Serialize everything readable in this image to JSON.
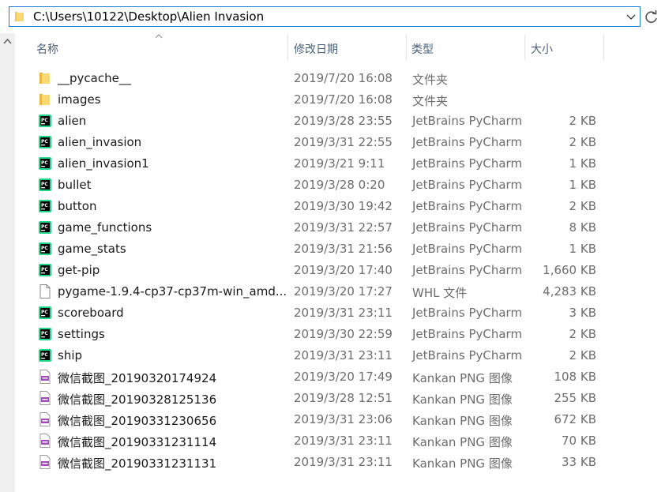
{
  "address_bar": {
    "path": "C:\\Users\\10122\\Desktop\\Alien Invasion"
  },
  "columns": {
    "name": "名称",
    "date": "修改日期",
    "type": "类型",
    "size": "大小"
  },
  "icons": {
    "folder": "folder-icon",
    "py": "pycharm-file-icon",
    "whl": "blank-file-icon",
    "png": "png-file-icon"
  },
  "colors": {
    "address_border": "#1e7bd6",
    "folder": "#f2c55c",
    "pycharm_green": "#21d789",
    "header_text": "#4c607a",
    "meta_text": "#6d6d6d"
  },
  "files": [
    {
      "name": "__pycache__",
      "date": "2019/7/20 16:08",
      "type": "文件夹",
      "size": "",
      "icon": "folder"
    },
    {
      "name": "images",
      "date": "2019/7/20 16:08",
      "type": "文件夹",
      "size": "",
      "icon": "folder"
    },
    {
      "name": "alien",
      "date": "2019/3/28 23:55",
      "type": "JetBrains PyCharm",
      "size": "2 KB",
      "icon": "py"
    },
    {
      "name": "alien_invasion",
      "date": "2019/3/31 22:55",
      "type": "JetBrains PyCharm",
      "size": "2 KB",
      "icon": "py"
    },
    {
      "name": "alien_invasion1",
      "date": "2019/3/21 9:11",
      "type": "JetBrains PyCharm",
      "size": "1 KB",
      "icon": "py"
    },
    {
      "name": "bullet",
      "date": "2019/3/28 0:20",
      "type": "JetBrains PyCharm",
      "size": "1 KB",
      "icon": "py"
    },
    {
      "name": "button",
      "date": "2019/3/30 19:42",
      "type": "JetBrains PyCharm",
      "size": "2 KB",
      "icon": "py"
    },
    {
      "name": "game_functions",
      "date": "2019/3/31 22:57",
      "type": "JetBrains PyCharm",
      "size": "8 KB",
      "icon": "py"
    },
    {
      "name": "game_stats",
      "date": "2019/3/31 21:56",
      "type": "JetBrains PyCharm",
      "size": "1 KB",
      "icon": "py"
    },
    {
      "name": "get-pip",
      "date": "2019/3/20 17:40",
      "type": "JetBrains PyCharm",
      "size": "1,660 KB",
      "icon": "py"
    },
    {
      "name": "pygame-1.9.4-cp37-cp37m-win_amd...",
      "date": "2019/3/20 17:27",
      "type": "WHL 文件",
      "size": "4,283 KB",
      "icon": "whl"
    },
    {
      "name": "scoreboard",
      "date": "2019/3/31 23:11",
      "type": "JetBrains PyCharm",
      "size": "3 KB",
      "icon": "py"
    },
    {
      "name": "settings",
      "date": "2019/3/30 22:59",
      "type": "JetBrains PyCharm",
      "size": "2 KB",
      "icon": "py"
    },
    {
      "name": "ship",
      "date": "2019/3/31 23:11",
      "type": "JetBrains PyCharm",
      "size": "2 KB",
      "icon": "py"
    },
    {
      "name": "微信截图_20190320174924",
      "date": "2019/3/20 17:49",
      "type": "Kankan PNG 图像",
      "size": "108 KB",
      "icon": "png"
    },
    {
      "name": "微信截图_20190328125136",
      "date": "2019/3/28 12:51",
      "type": "Kankan PNG 图像",
      "size": "255 KB",
      "icon": "png"
    },
    {
      "name": "微信截图_20190331230656",
      "date": "2019/3/31 23:06",
      "type": "Kankan PNG 图像",
      "size": "672 KB",
      "icon": "png"
    },
    {
      "name": "微信截图_20190331231114",
      "date": "2019/3/31 23:11",
      "type": "Kankan PNG 图像",
      "size": "70 KB",
      "icon": "png"
    },
    {
      "name": "微信截图_20190331231131",
      "date": "2019/3/31 23:11",
      "type": "Kankan PNG 图像",
      "size": "33 KB",
      "icon": "png"
    }
  ]
}
